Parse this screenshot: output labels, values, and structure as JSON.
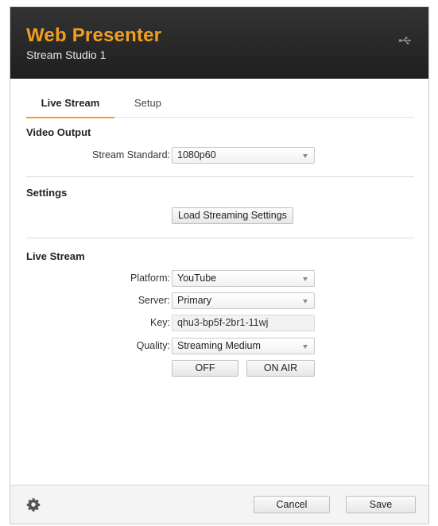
{
  "header": {
    "title": "Web Presenter",
    "subtitle": "Stream Studio 1",
    "usb_icon": "usb-icon"
  },
  "tabs": [
    {
      "label": "Live Stream",
      "active": true
    },
    {
      "label": "Setup",
      "active": false
    }
  ],
  "video_output": {
    "title": "Video Output",
    "stream_standard_label": "Stream Standard:",
    "stream_standard_value": "1080p60"
  },
  "settings": {
    "title": "Settings",
    "load_button": "Load Streaming Settings"
  },
  "live_stream": {
    "title": "Live Stream",
    "platform_label": "Platform:",
    "platform_value": "YouTube",
    "server_label": "Server:",
    "server_value": "Primary",
    "key_label": "Key:",
    "key_value": "qhu3-bp5f-2br1-11wj",
    "quality_label": "Quality:",
    "quality_value": "Streaming Medium",
    "off_button": "OFF",
    "on_air_button": "ON AIR"
  },
  "footer": {
    "settings_icon": "gear-icon",
    "cancel_button": "Cancel",
    "save_button": "Save"
  },
  "colors": {
    "accent": "#f0a020",
    "header_bg": "#2a2a2a"
  }
}
